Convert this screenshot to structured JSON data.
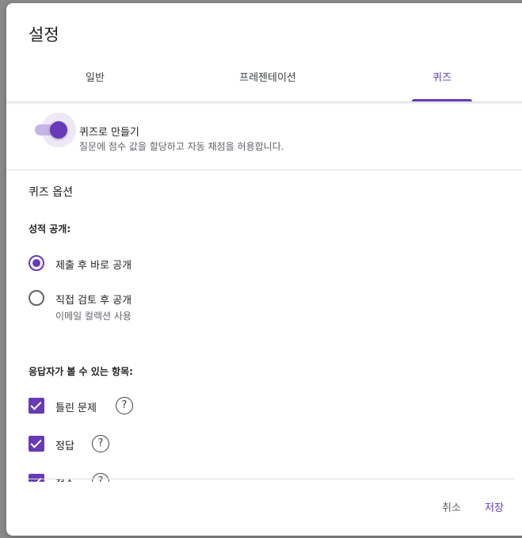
{
  "dialog": {
    "title": "설정"
  },
  "tabs": [
    {
      "label": "일반",
      "active": false
    },
    {
      "label": "프레젠테이션",
      "active": false
    },
    {
      "label": "퀴즈",
      "active": true
    }
  ],
  "quiz_toggle": {
    "label": "퀴즈로 만들기",
    "description": "질문에 점수 값을 할당하고 자동 채점을 허용합니다.",
    "enabled": true
  },
  "quiz_options": {
    "section_title": "퀴즈 옵션",
    "release_grade": {
      "heading": "성적 공개:",
      "options": [
        {
          "label": "제출 후 바로 공개",
          "selected": true,
          "sublabel": ""
        },
        {
          "label": "직접 검토 후 공개",
          "selected": false,
          "sublabel": "이메일 컬렉션 사용"
        }
      ]
    },
    "respondent_can_see": {
      "heading": "응답자가 볼 수 있는 항목:",
      "items": [
        {
          "label": "틀린 문제",
          "checked": true
        },
        {
          "label": "정답",
          "checked": true
        },
        {
          "label": "점수",
          "checked": true
        }
      ]
    }
  },
  "footer": {
    "cancel_label": "취소",
    "save_label": "저장"
  },
  "colors": {
    "accent": "#673ab7",
    "overlay": "#8a8a8a"
  }
}
